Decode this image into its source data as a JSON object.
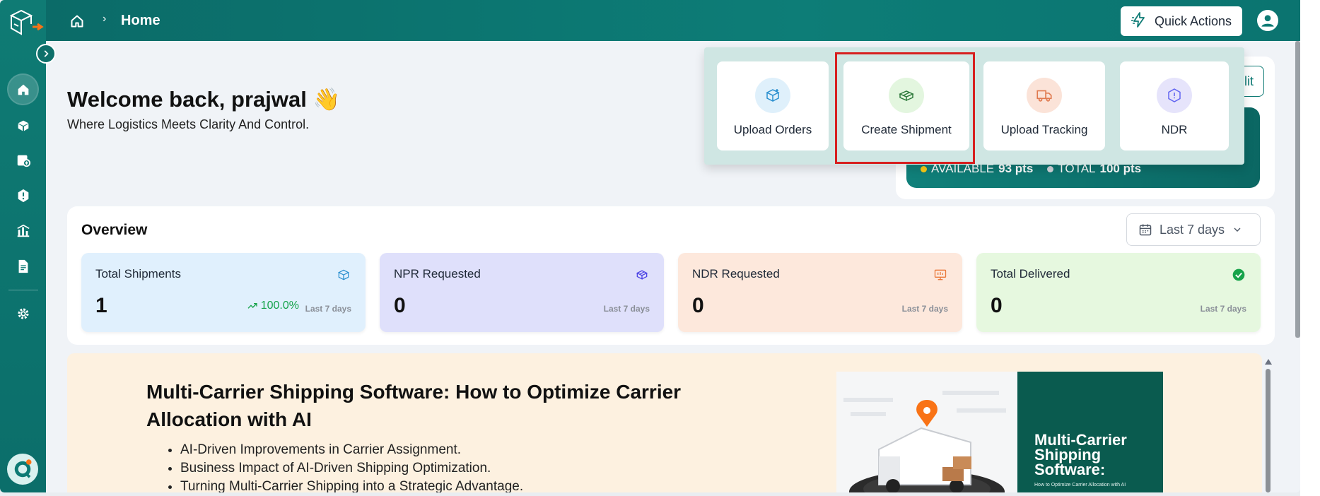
{
  "breadcrumb": {
    "title": "Home"
  },
  "topbar": {
    "quick_actions_label": "Quick Actions"
  },
  "welcome": {
    "title": "Welcome back, prajwal 👋",
    "subtitle": "Where Logistics Meets Clarity And Control."
  },
  "quick_actions_menu": [
    {
      "label": "Upload Orders",
      "icon": "package-upload-icon",
      "color": "#dff0fb"
    },
    {
      "label": "Create Shipment",
      "icon": "shipment-box-icon",
      "color": "#e3f6df"
    },
    {
      "label": "Upload Tracking",
      "icon": "truck-icon",
      "color": "#fbe3d8"
    },
    {
      "label": "NDR",
      "icon": "hexagon-alert-icon",
      "color": "#e6e4fb"
    }
  ],
  "credits": {
    "edit_label": "lit",
    "available_label": "AVAILABLE",
    "available_value": "93 pts",
    "total_label": "TOTAL",
    "total_value": "100 pts"
  },
  "overview": {
    "title": "Overview",
    "range": "Last 7 days",
    "cards": [
      {
        "label": "Total Shipments",
        "value": "1",
        "change": "100.0%",
        "period": "Last 7 days",
        "bg": "#e0f0fd",
        "icon": "cube-icon"
      },
      {
        "label": "NPR Requested",
        "value": "0",
        "period": "Last 7 days",
        "bg": "#dfe0fb",
        "icon": "box-return-icon"
      },
      {
        "label": "NDR Requested",
        "value": "0",
        "period": "Last 7 days",
        "bg": "#fde8dc",
        "icon": "presentation-icon"
      },
      {
        "label": "Total Delivered",
        "value": "0",
        "period": "Last 7 days",
        "bg": "#e6f8df",
        "icon": "check-circle-icon"
      }
    ]
  },
  "banner": {
    "title": "Multi-Carrier Shipping Software: How to Optimize Carrier Allocation with AI",
    "bullets": [
      "AI-Driven Improvements in Carrier Assignment.",
      "Business Impact of AI-Driven Shipping Optimization.",
      "Turning Multi-Carrier Shipping into a Strategic Advantage."
    ],
    "image_title": "Multi-Carrier Shipping Software:",
    "image_subtitle": "How to Optimize Carrier Allocation with AI"
  }
}
